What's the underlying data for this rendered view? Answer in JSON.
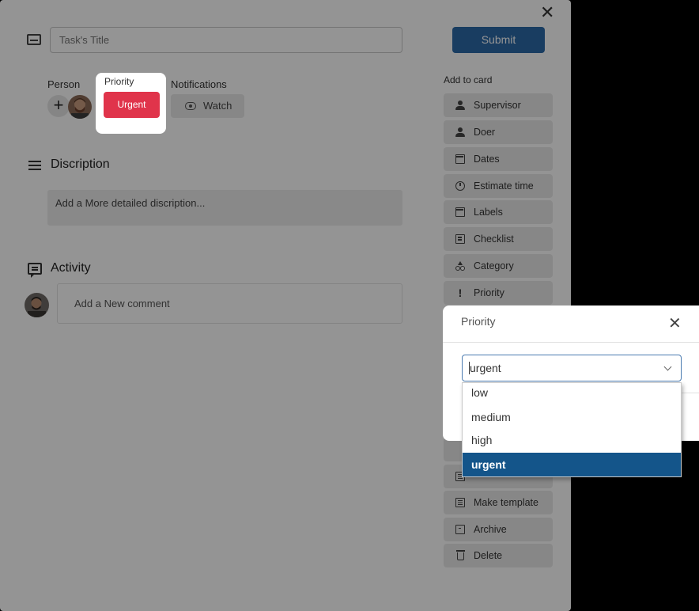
{
  "task": {
    "title_placeholder": "Task's Title",
    "submit_label": "Submit",
    "close_icon": "close-icon"
  },
  "members": {
    "person_label": "Person",
    "priority_label": "Priority",
    "priority_value": "Urgent",
    "notifications_label": "Notifications",
    "watch_label": "Watch"
  },
  "description": {
    "title": "Discription",
    "placeholder": "Add a More detailed discription..."
  },
  "activity": {
    "title": "Activity",
    "comment_placeholder": "Add a New comment"
  },
  "sidebar": {
    "heading": "Add to card",
    "items": [
      {
        "label": "Supervisor",
        "icon": "person-icon"
      },
      {
        "label": "Doer",
        "icon": "person-check-icon"
      },
      {
        "label": "Dates",
        "icon": "calendar-icon"
      },
      {
        "label": "Estimate time",
        "icon": "stopwatch-icon"
      },
      {
        "label": "Labels",
        "icon": "calendar-check-icon"
      },
      {
        "label": "Checklist",
        "icon": "checklist-icon"
      },
      {
        "label": "Category",
        "icon": "category-icon"
      },
      {
        "label": "Priority",
        "icon": "exclamation-icon"
      }
    ],
    "actions": [
      {
        "label": "Make template",
        "icon": "template-icon"
      },
      {
        "label": "Archive",
        "icon": "archive-icon"
      },
      {
        "label": "Delete",
        "icon": "trash-icon"
      }
    ]
  },
  "priority_popup": {
    "title": "Priority",
    "selected": "urgent",
    "options": [
      "low",
      "medium",
      "high",
      "urgent"
    ]
  },
  "colors": {
    "submit": "#2c6aa8",
    "urgent": "#e0344b",
    "selected_option": "#14558a"
  }
}
